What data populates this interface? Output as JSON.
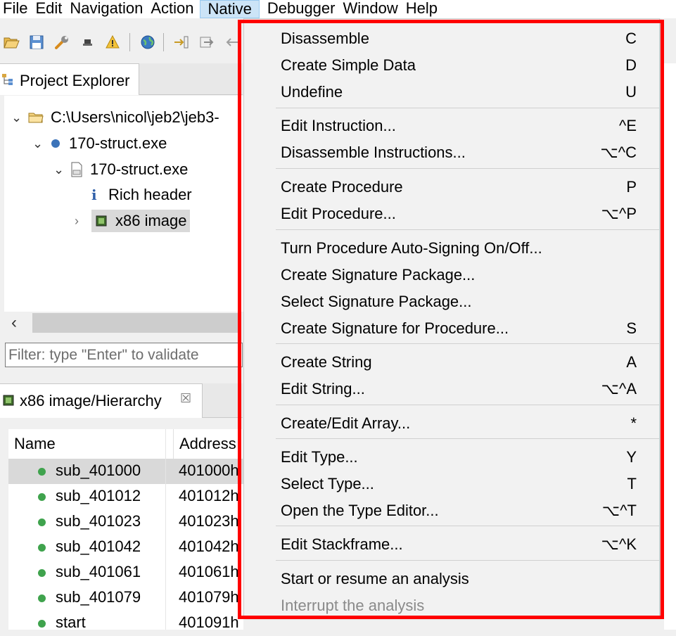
{
  "menubar": {
    "items": [
      {
        "label": "File"
      },
      {
        "label": "Edit"
      },
      {
        "label": "Navigation"
      },
      {
        "label": "Action"
      },
      {
        "label": "Native"
      },
      {
        "label": "Debugger"
      },
      {
        "label": "Window"
      },
      {
        "label": "Help"
      }
    ]
  },
  "toolbar": {
    "icons": [
      "open-folder-icon",
      "save-icon",
      "wrench-icon",
      "stamp-icon",
      "warning-icon",
      "globe-icon",
      "step-into-icon",
      "step-over-icon",
      "back-arrow-icon"
    ]
  },
  "project_explorer": {
    "tab_label": "Project Explorer",
    "tree": [
      {
        "label": "C:\\Users\\nicol\\jeb2\\jeb3-",
        "icon": "folder-icon",
        "expanded": true
      },
      {
        "label": "170-struct.exe",
        "icon": "artifact-dot-icon",
        "expanded": true
      },
      {
        "label": "170-struct.exe",
        "icon": "pe-file-icon",
        "expanded": true
      },
      {
        "label": "Rich header",
        "icon": "info-icon"
      },
      {
        "label": "x86 image",
        "icon": "chip-icon",
        "expanded": false,
        "selected": true
      }
    ],
    "filter_placeholder": "Filter: type \"Enter\" to validate"
  },
  "hierarchy": {
    "tab_label": "x86 image/Hierarchy",
    "close_glyph": "☒",
    "columns": [
      "Name",
      "Address"
    ],
    "rows": [
      {
        "name": "sub_401000",
        "address": "401000h",
        "selected": true
      },
      {
        "name": "sub_401012",
        "address": "401012h"
      },
      {
        "name": "sub_401023",
        "address": "401023h"
      },
      {
        "name": "sub_401042",
        "address": "401042h"
      },
      {
        "name": "sub_401061",
        "address": "401061h"
      },
      {
        "name": "sub_401079",
        "address": "401079h"
      },
      {
        "name": "start",
        "address": "401091h"
      }
    ]
  },
  "native_menu": {
    "groups": [
      [
        {
          "label": "Disassemble",
          "shortcut": "C"
        },
        {
          "label": "Create Simple Data",
          "shortcut": "D"
        },
        {
          "label": "Undefine",
          "shortcut": "U"
        }
      ],
      [
        {
          "label": "Edit Instruction...",
          "shortcut": "^E"
        },
        {
          "label": "Disassemble Instructions...",
          "shortcut": "⌥^C"
        }
      ],
      [
        {
          "label": "Create Procedure",
          "shortcut": "P"
        },
        {
          "label": "Edit Procedure...",
          "shortcut": "⌥^P"
        }
      ],
      [
        {
          "label": "Turn Procedure Auto-Signing On/Off...",
          "shortcut": ""
        },
        {
          "label": "Create Signature Package...",
          "shortcut": ""
        },
        {
          "label": "Select Signature Package...",
          "shortcut": ""
        },
        {
          "label": "Create Signature for Procedure...",
          "shortcut": "S"
        }
      ],
      [
        {
          "label": "Create String",
          "shortcut": "A"
        },
        {
          "label": "Edit String...",
          "shortcut": "⌥^A"
        }
      ],
      [
        {
          "label": "Create/Edit Array...",
          "shortcut": "*"
        }
      ],
      [
        {
          "label": "Edit Type...",
          "shortcut": "Y"
        },
        {
          "label": "Select Type...",
          "shortcut": "T"
        },
        {
          "label": "Open the Type Editor...",
          "shortcut": "⌥^T"
        }
      ],
      [
        {
          "label": "Edit Stackframe...",
          "shortcut": "⌥^K"
        }
      ],
      [
        {
          "label": "Start or resume an analysis",
          "shortcut": ""
        },
        {
          "label": "Interrupt the analysis",
          "shortcut": "",
          "disabled": true
        }
      ]
    ]
  },
  "colors": {
    "menu_highlight": "#cce4f7",
    "annotation_box": "#ff0000",
    "routine_dot": "#3fa34d",
    "selection": "#d9d9d9"
  }
}
